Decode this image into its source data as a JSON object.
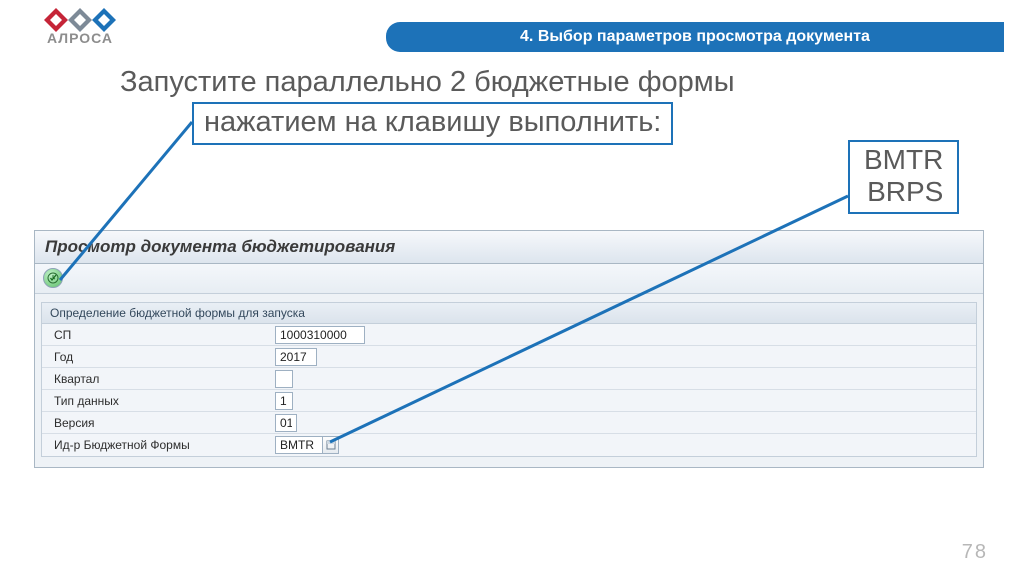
{
  "ribbon_title": "4. Выбор параметров просмотра документа",
  "logo_text": "АЛРОСА",
  "headline": "Запустите параллельно 2 бюджетные формы",
  "subhead": "нажатием на клавишу выполнить:",
  "code_box": {
    "line1": "BMTR",
    "line2": "BRPS"
  },
  "panel": {
    "title": "Просмотр документа бюджетирования",
    "group_title": "Определение бюджетной формы для запуска",
    "fields": {
      "sp": {
        "label": "СП",
        "value": "1000310000"
      },
      "year": {
        "label": "Год",
        "value": "2017"
      },
      "quarter": {
        "label": "Квартал",
        "value": ""
      },
      "data_type": {
        "label": "Тип данных",
        "value": "1"
      },
      "version": {
        "label": "Версия",
        "value": "01"
      },
      "form_id": {
        "label": "Ид-р Бюджетной Формы",
        "value": "BMTR"
      }
    }
  },
  "page_number": "78"
}
